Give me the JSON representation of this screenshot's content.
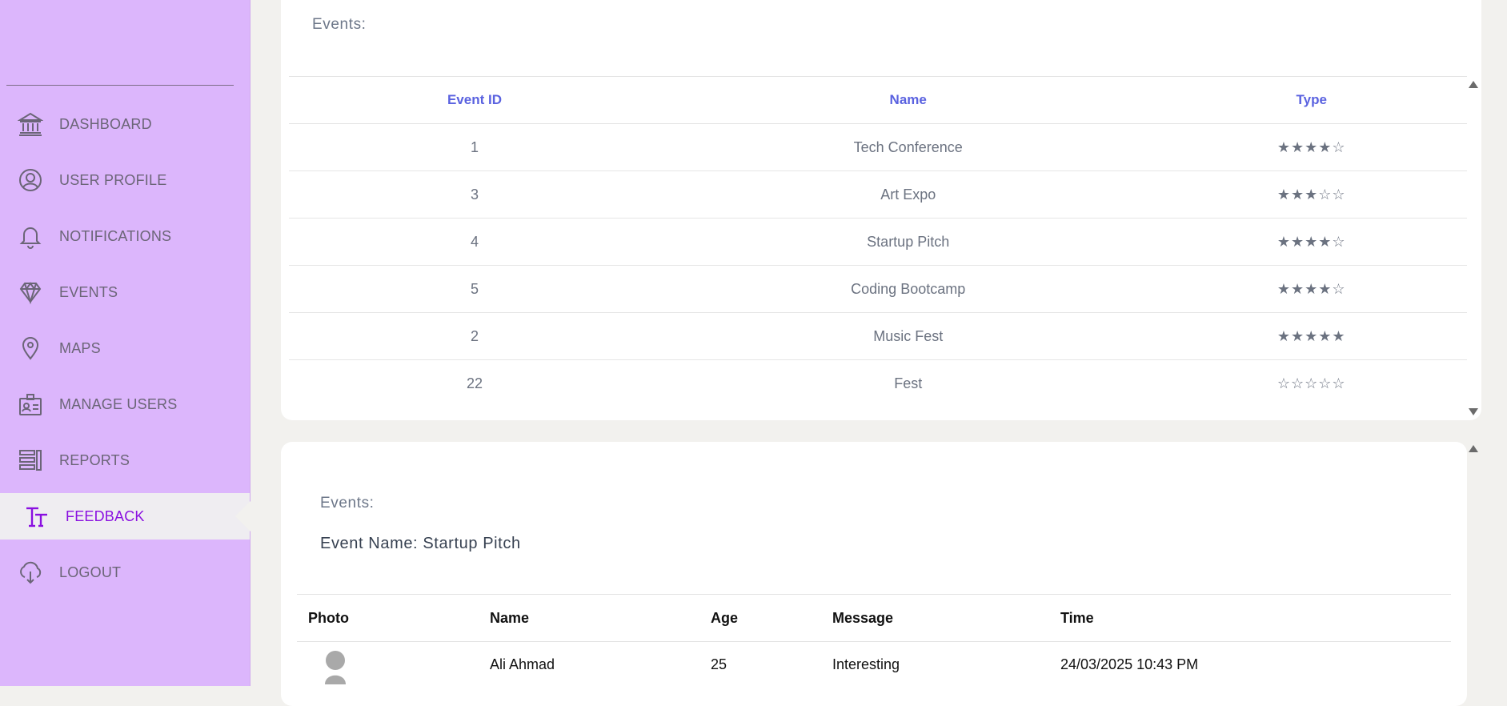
{
  "sidebar": {
    "items": [
      {
        "label": "DASHBOARD",
        "icon": "bank-icon",
        "name": "sidebar-item-dashboard"
      },
      {
        "label": "USER PROFILE",
        "icon": "user-circle-icon",
        "name": "sidebar-item-user-profile"
      },
      {
        "label": "NOTIFICATIONS",
        "icon": "bell-icon",
        "name": "sidebar-item-notifications"
      },
      {
        "label": "EVENTS",
        "icon": "diamond-icon",
        "name": "sidebar-item-events"
      },
      {
        "label": "MAPS",
        "icon": "map-pin-icon",
        "name": "sidebar-item-maps"
      },
      {
        "label": "MANAGE USERS",
        "icon": "id-badge-icon",
        "name": "sidebar-item-manage-users"
      },
      {
        "label": "REPORTS",
        "icon": "report-icon",
        "name": "sidebar-item-reports"
      },
      {
        "label": "FEEDBACK",
        "icon": "text-size-icon",
        "name": "sidebar-item-feedback",
        "active": true
      },
      {
        "label": "LOGOUT",
        "icon": "cloud-download-icon",
        "name": "sidebar-item-logout"
      }
    ]
  },
  "events_card": {
    "title": "Events:",
    "columns": [
      "Event ID",
      "Name",
      "Type"
    ],
    "rows": [
      {
        "id": "1",
        "name": "Tech Conference",
        "rating": 4
      },
      {
        "id": "3",
        "name": "Art Expo",
        "rating": 3
      },
      {
        "id": "4",
        "name": "Startup Pitch",
        "rating": 4
      },
      {
        "id": "5",
        "name": "Coding Bootcamp",
        "rating": 4
      },
      {
        "id": "2",
        "name": "Music Fest",
        "rating": 5
      },
      {
        "id": "22",
        "name": "Fest",
        "rating": 0
      }
    ],
    "max_rating": 5
  },
  "feedback_card": {
    "title": "Events:",
    "event_name": "Event Name: Startup Pitch",
    "columns": [
      "Photo",
      "Name",
      "Age",
      "Message",
      "Time"
    ],
    "rows": [
      {
        "name": "Ali Ahmad",
        "age": "25",
        "message": "Interesting",
        "time": "24/03/2025 10:43 PM"
      }
    ]
  },
  "colors": {
    "sidebar_bg": "#dcb6fc",
    "accent_active": "#8a10e0",
    "header_blue": "#5a62e0",
    "star_gold": "#f5b800"
  }
}
